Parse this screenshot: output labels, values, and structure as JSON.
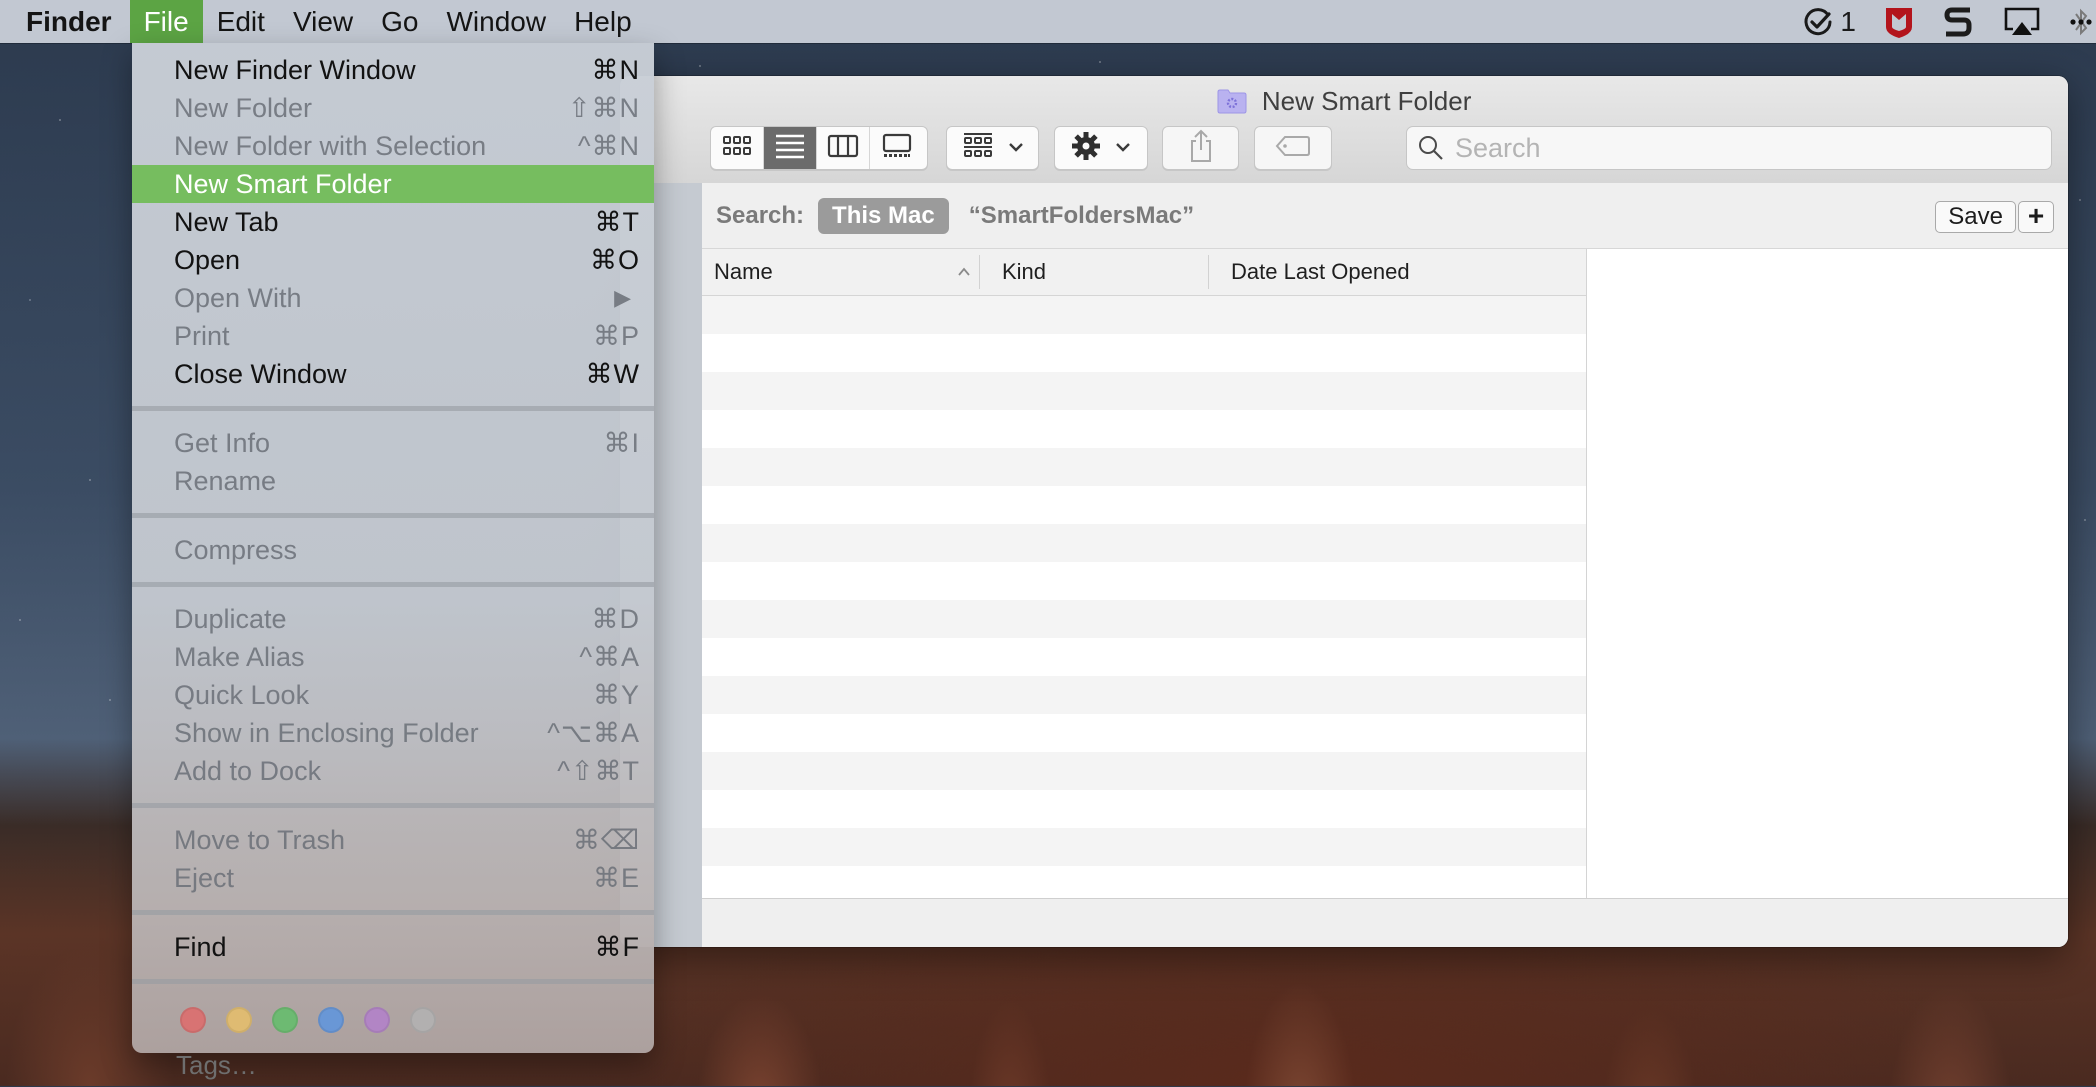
{
  "menubar": {
    "app_name": "Finder",
    "items": [
      "File",
      "Edit",
      "View",
      "Go",
      "Window",
      "Help"
    ],
    "active_item": "File",
    "status_icons": [
      {
        "name": "checkmark-badge-icon",
        "count": "1"
      },
      {
        "name": "mcafee-shield-icon"
      },
      {
        "name": "s-app-icon"
      },
      {
        "name": "airplay-icon"
      },
      {
        "name": "bluetooth-icon"
      }
    ]
  },
  "file_menu": {
    "groups": [
      [
        {
          "label": "New Finder Window",
          "shortcut": "⌘N",
          "enabled": true
        },
        {
          "label": "New Folder",
          "shortcut": "⇧⌘N",
          "enabled": false
        },
        {
          "label": "New Folder with Selection",
          "shortcut": "^⌘N",
          "enabled": false
        },
        {
          "label": "New Smart Folder",
          "shortcut": "",
          "enabled": true,
          "highlighted": true
        },
        {
          "label": "New Tab",
          "shortcut": "⌘T",
          "enabled": true
        },
        {
          "label": "Open",
          "shortcut": "⌘O",
          "enabled": true
        },
        {
          "label": "Open With",
          "shortcut": "▶",
          "enabled": false
        },
        {
          "label": "Print",
          "shortcut": "⌘P",
          "enabled": false
        },
        {
          "label": "Close Window",
          "shortcut": "⌘W",
          "enabled": true
        }
      ],
      [
        {
          "label": "Get Info",
          "shortcut": "⌘I",
          "enabled": false
        },
        {
          "label": "Rename",
          "shortcut": "",
          "enabled": false
        }
      ],
      [
        {
          "label": "Compress",
          "shortcut": "",
          "enabled": false
        }
      ],
      [
        {
          "label": "Duplicate",
          "shortcut": "⌘D",
          "enabled": false
        },
        {
          "label": "Make Alias",
          "shortcut": "^⌘A",
          "enabled": false
        },
        {
          "label": "Quick Look",
          "shortcut": "⌘Y",
          "enabled": false
        },
        {
          "label": "Show in Enclosing Folder",
          "shortcut": "^⌥⌘A",
          "enabled": false
        },
        {
          "label": "Add to Dock",
          "shortcut": "^⇧⌘T",
          "enabled": false
        }
      ],
      [
        {
          "label": "Move to Trash",
          "shortcut": "⌘⌫",
          "enabled": false
        },
        {
          "label": "Eject",
          "shortcut": "⌘E",
          "enabled": false
        }
      ],
      [
        {
          "label": "Find",
          "shortcut": "⌘F",
          "enabled": true
        }
      ]
    ],
    "tag_colors": [
      {
        "name": "red",
        "color": "#e06b6b"
      },
      {
        "name": "orange-yellow",
        "color": "#e8c06a"
      },
      {
        "name": "green",
        "color": "#62bf6a"
      },
      {
        "name": "blue",
        "color": "#5d95e0"
      },
      {
        "name": "purple",
        "color": "#b380cc"
      },
      {
        "name": "gray",
        "color": "#b3b3b3"
      }
    ],
    "tags_label": "Tags…"
  },
  "window": {
    "title": "New Smart Folder",
    "toolbar": {
      "view_modes": [
        "icon-view",
        "list-view",
        "column-view",
        "gallery-view"
      ],
      "selected_view": "list-view",
      "group_button": "group-by",
      "action_button": "action-gear",
      "share_button": "share",
      "tag_button": "tag",
      "search_placeholder": "Search",
      "search_value": ""
    },
    "scope_bar": {
      "label": "Search:",
      "scope": "This Mac",
      "query": "“SmartFoldersMac”",
      "save_label": "Save",
      "add_label": "+"
    },
    "columns": [
      {
        "label": "Name",
        "sorted": "ascending"
      },
      {
        "label": "Kind"
      },
      {
        "label": "Date Last Opened"
      }
    ],
    "rows": []
  },
  "colors": {
    "menu_highlight": "#76bd5f",
    "menubar_active": "#5ca444",
    "scope_pill": "#9b9b9b"
  }
}
